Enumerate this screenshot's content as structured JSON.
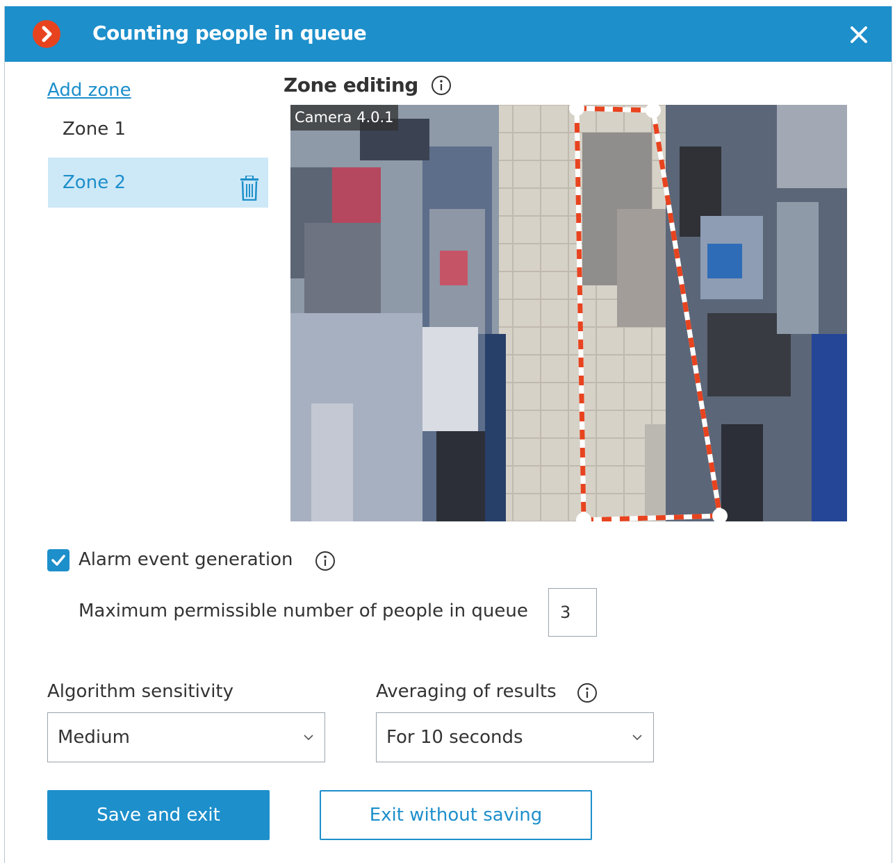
{
  "dialog": {
    "title": "Counting people in queue",
    "close_icon": "close-icon",
    "app_icon": "chevron-right-circle-icon",
    "accent_color": "#1d8fcb",
    "brand_color": "#e8431f"
  },
  "zones": {
    "add_label": "Add zone",
    "items": [
      {
        "label": "Zone 1",
        "selected": false
      },
      {
        "label": "Zone 2",
        "selected": true
      }
    ],
    "delete_icon": "trash-icon"
  },
  "editor": {
    "title": "Zone editing",
    "camera_label": "Camera 4.0.1"
  },
  "alarm": {
    "checked": true,
    "label": "Alarm event generation",
    "max_label": "Maximum permissible number of people in queue",
    "max_value": "3"
  },
  "sensitivity": {
    "label": "Algorithm sensitivity",
    "value": "Medium"
  },
  "averaging": {
    "label": "Averaging of results",
    "value": "For 10 seconds"
  },
  "buttons": {
    "save": "Save and exit",
    "exit": "Exit without saving"
  }
}
